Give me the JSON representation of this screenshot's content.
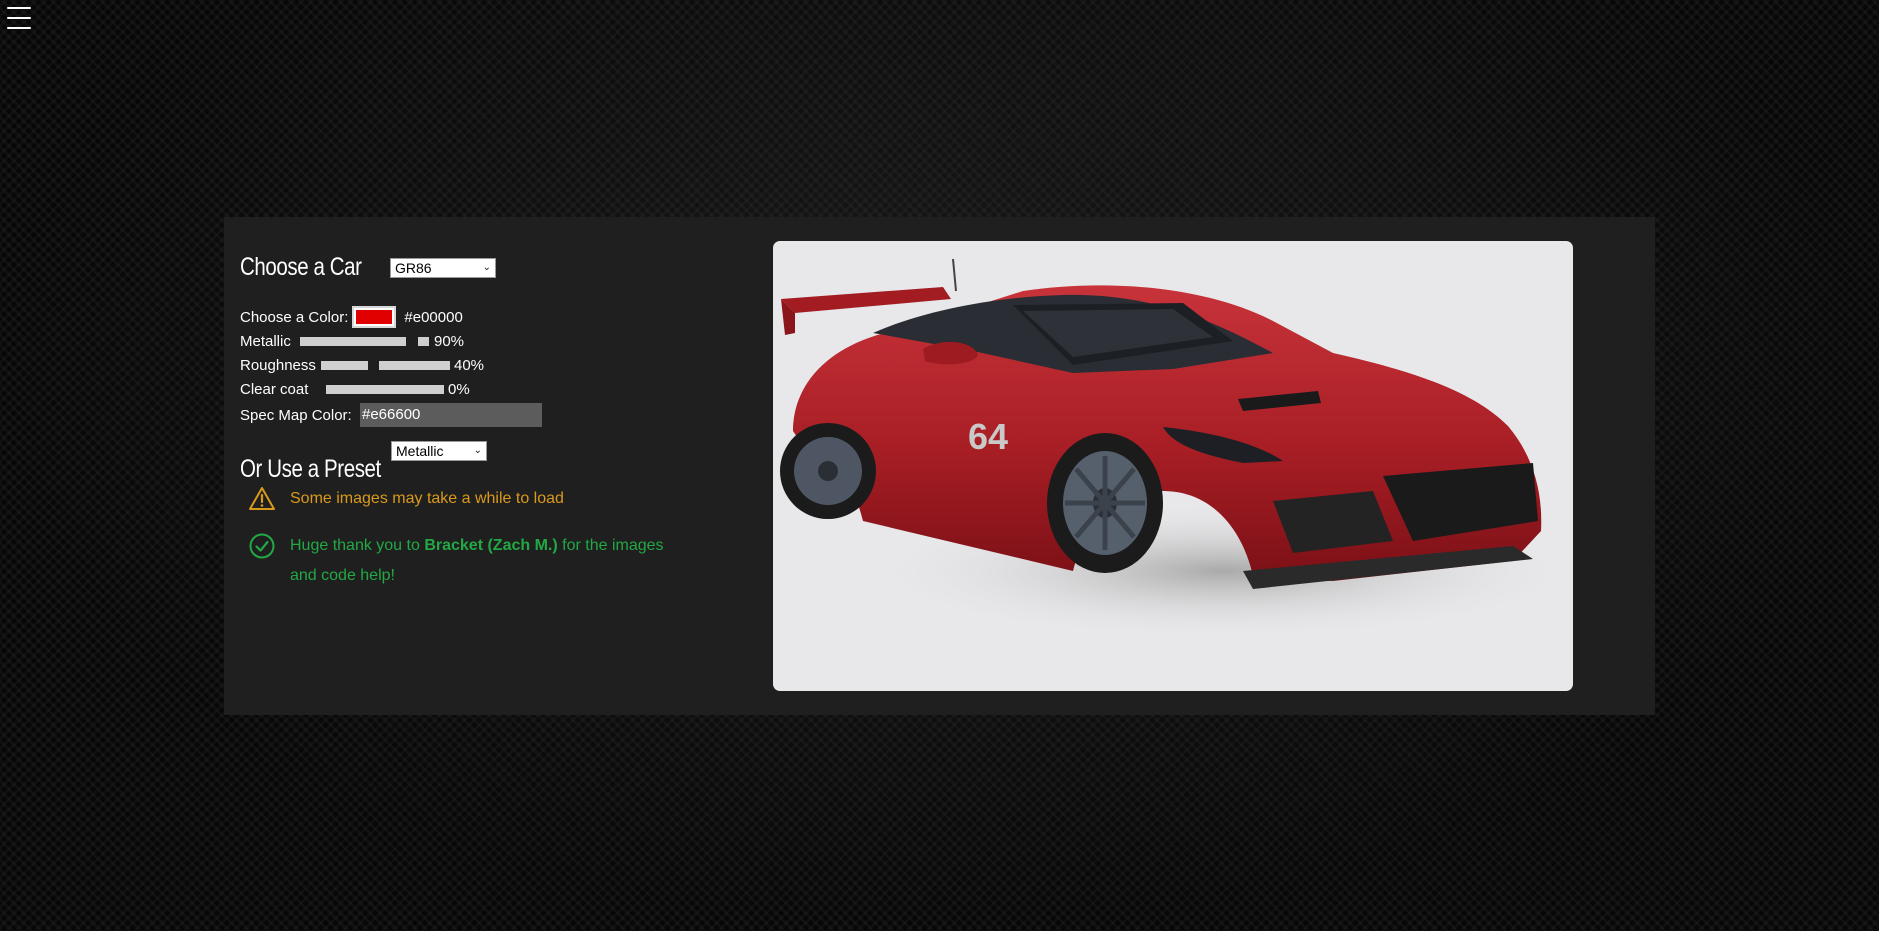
{
  "menu": {
    "icon": "hamburger-icon"
  },
  "car": {
    "heading": "Choose a Car",
    "selected": "GR86",
    "number": "64"
  },
  "color": {
    "label": "Choose a Color:",
    "value": "#e00000",
    "swatch": "#e00000"
  },
  "metallic": {
    "label": "Metallic",
    "value": "90%",
    "level": 0.9
  },
  "roughness": {
    "label": "Roughness",
    "value": "40%",
    "level": 0.4
  },
  "clearcoat": {
    "label": "Clear coat",
    "value": "0%",
    "level": 0.0
  },
  "spec": {
    "label": "Spec Map Color:",
    "value": "#e66600"
  },
  "preset": {
    "heading": "Or Use a Preset",
    "selected": "Metallic"
  },
  "notices": {
    "warning": "Some images may take a while to load",
    "thanks_prefix": "Huge thank you to ",
    "thanks_name": "Bracket (Zach M.)",
    "thanks_suffix": " for the images and code help!"
  },
  "colors": {
    "panel": "#1f1f1f",
    "warning": "#d99a1c",
    "success": "#22a844",
    "car_body": "#b3232a"
  }
}
